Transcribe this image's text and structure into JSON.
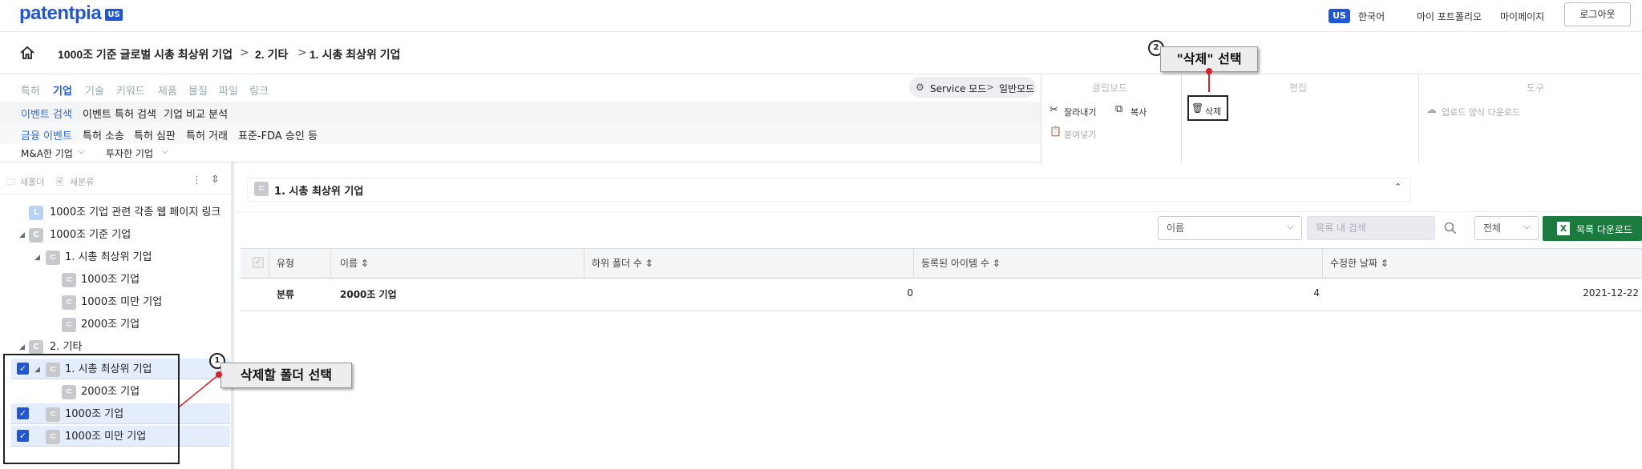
{
  "header": {
    "logo": "patentpia",
    "logo_badge": "US",
    "lang_badge": "US",
    "lang": "한국어",
    "nav": [
      "마이 포트폴리오",
      "마이페이지"
    ],
    "logout": "로그아웃"
  },
  "breadcrumb": {
    "items": [
      "1000조 기준 글로벌 시총 최상위 기업",
      "2. 기타",
      "1. 시총 최상위 기업"
    ],
    "separator": ">"
  },
  "menu": {
    "tabs": [
      "특허",
      "기업",
      "기술",
      "키워드",
      "제품",
      "물질",
      "파일",
      "링크"
    ],
    "active_tab": "기업",
    "sub1": [
      "이벤트 검색",
      "이벤트 특허 검색",
      "기업 비교 분석"
    ],
    "sub1_active": "이벤트 검색",
    "sub2": [
      "금융 이벤트",
      "특허 소송",
      "특허 심판",
      "특허 거래",
      "표준-FDA 승인 등"
    ],
    "sub2_active": "금융 이벤트",
    "sub3": [
      "M&A한 기업",
      "투자한 기업"
    ]
  },
  "mode": {
    "service": "Service 모드",
    "sep": ">",
    "normal": "일반모드"
  },
  "panels": {
    "clipboard": {
      "title": "클립보드",
      "cut": "잘라내기",
      "copy": "복사",
      "paste": "붙여넣기"
    },
    "edit": {
      "title": "편집",
      "delete": "삭제"
    },
    "tools": {
      "title": "도구",
      "upload": "업로드 양식 다운로드"
    }
  },
  "tree": {
    "new_folder": "새폴더",
    "new_category": "새분류",
    "items": [
      {
        "icon": "L",
        "label": "1000조 기업 관련 각종 웹 페이지 링크"
      },
      {
        "icon": "C",
        "label": "1000조 기준 기업"
      },
      {
        "icon": "⊂",
        "label": "1. 시총 최상위 기업"
      },
      {
        "icon": "⊂",
        "label": "1000조 기업"
      },
      {
        "icon": "⊂",
        "label": "1000조 미만 기업"
      },
      {
        "icon": "⊂",
        "label": "2000조 기업"
      },
      {
        "icon": "C",
        "label": "2. 기타"
      },
      {
        "icon": "⊂",
        "label": "1. 시총 최상위 기업"
      },
      {
        "icon": "⊂",
        "label": "2000조 기업"
      },
      {
        "icon": "⊂",
        "label": "1000조 기업"
      },
      {
        "icon": "⊂",
        "label": "1000조 미만 기업"
      }
    ]
  },
  "main": {
    "title": "1. 시총 최상위 기업",
    "sort_select": "이름",
    "search_placeholder": "목록 내 검색",
    "scope_select": "전체",
    "download": "목록 다운로드",
    "columns": [
      "유형",
      "이름 ⇕",
      "하위 폴더 수 ⇕",
      "등록된 아이템 수 ⇕",
      "수정한 날짜 ⇕"
    ],
    "rows": [
      {
        "type": "분류",
        "name": "2000조 기업",
        "subfolders": "0",
        "items": "4",
        "modified": "2021-12-22"
      }
    ]
  },
  "callouts": {
    "one_num": "1",
    "one_text": "삭제할 폴더 선택",
    "two_num": "2",
    "two_text": "\"삭제\" 선택"
  },
  "colors": {
    "accent": "#2057d6",
    "excel": "#1b7a3d",
    "callout_line": "#d81f2a"
  }
}
